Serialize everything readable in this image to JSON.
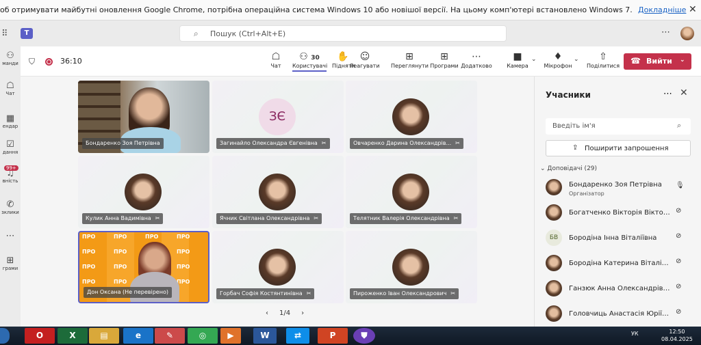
{
  "infobar": {
    "message": "об отримувати майбутні оновлення Google Chrome, потрібна операційна система Windows 10 або новішої версії. На цьому комп'ютері встановлено Windows 7.",
    "more": "Докладніше",
    "close": "✕"
  },
  "teams": {
    "search_placeholder": "Пошук (Ctrl+Alt+E)",
    "more": "⋯"
  },
  "rail": [
    {
      "label": "манди",
      "icon": "⚇"
    },
    {
      "label": "Чат",
      "icon": "☖"
    },
    {
      "label": "ендар",
      "icon": "▦"
    },
    {
      "label": "дання",
      "icon": "☑"
    },
    {
      "label": "вність",
      "icon": "♫"
    },
    {
      "label": "зклики",
      "icon": "✆"
    },
    {
      "label": "",
      "icon": "⋯"
    },
    {
      "label": "грами",
      "icon": "⊞"
    }
  ],
  "rail_badge": "99+",
  "meeting": {
    "timer": "36:10",
    "participants_count": "30"
  },
  "toolbar": [
    {
      "label": "Чат",
      "icon": "☖"
    },
    {
      "label": "Користувачі",
      "icon": "⚇"
    },
    {
      "label": "Підняти",
      "icon": "✋"
    },
    {
      "label": "Реагувати",
      "icon": "☺"
    },
    {
      "label": "Переглянути",
      "icon": "⊞"
    },
    {
      "label": "Програми",
      "icon": "⊞"
    },
    {
      "label": "Додатково",
      "icon": "⋯"
    },
    {
      "label": "Камера",
      "icon": "■"
    },
    {
      "label": "Мікрофон",
      "icon": "♦"
    },
    {
      "label": "Поділитися",
      "icon": "⇧"
    }
  ],
  "leave": {
    "label": "Вийти",
    "icon": "☎"
  },
  "tiles": [
    {
      "name": "Бондаренко Зоя Петрівна",
      "muted": false,
      "kind": "video1"
    },
    {
      "name": "Загинайло Олександра Євгенівна",
      "muted": true,
      "initials": "ЗЄ"
    },
    {
      "name": "Овчаренко Дарина Олександрів...",
      "muted": true
    },
    {
      "name": "Кулик Анна Вадимівна",
      "muted": true
    },
    {
      "name": "Ячник Світлана Олександрівна",
      "muted": true
    },
    {
      "name": "Телятник Валерія Олександрівна",
      "muted": true
    },
    {
      "name": "Дон Оксана (Не перевірено)",
      "muted": false,
      "kind": "video2"
    },
    {
      "name": "Горбач Софія Костянтинівна",
      "muted": true
    },
    {
      "name": "Пироженко Іван Олександрович",
      "muted": true
    }
  ],
  "pro_text": "ПРО",
  "pager": {
    "prev": "‹",
    "page": "1/4",
    "next": "›"
  },
  "panel": {
    "title": "Учасники",
    "more": "⋯",
    "close": "✕",
    "search_placeholder": "Введіть ім'я",
    "share_label": "Поширити запрошення",
    "section": "Доповідачі (29)",
    "people": [
      {
        "name": "Бондаренко Зоя Петрівна",
        "role": "Організатор",
        "mic": "on"
      },
      {
        "name": "Богатченко Вікторія Вікторі...",
        "role": "",
        "mic": "off"
      },
      {
        "name": "Бородіна Інна Віталіївна",
        "role": "",
        "mic": "off",
        "initials": "БВ"
      },
      {
        "name": "Бородіна Катерина Віталіївна",
        "role": "",
        "mic": "off"
      },
      {
        "name": "Ганзюк Анна Олександрівна",
        "role": "",
        "mic": "off"
      },
      {
        "name": "Головчиць Анастасія Юріївна",
        "role": "",
        "mic": "off"
      }
    ]
  },
  "taskbar": {
    "time": "12:50",
    "date": "08.04.2025",
    "lang": "УК"
  }
}
